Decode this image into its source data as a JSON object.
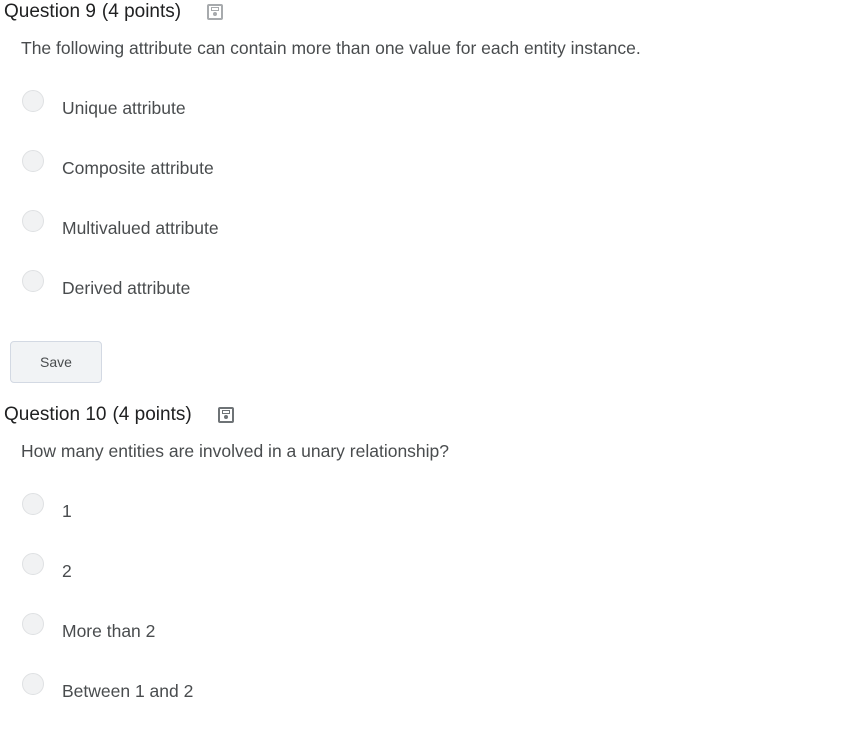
{
  "questions": [
    {
      "title": "Question 9",
      "points": "(4 points)",
      "prompt": "The following attribute can contain more than one value for each entity instance.",
      "options": [
        {
          "label": "Unique attribute"
        },
        {
          "label": "Composite attribute"
        },
        {
          "label": "Multivalued attribute"
        },
        {
          "label": "Derived attribute"
        }
      ]
    },
    {
      "title": "Question 10",
      "points": "(4 points)",
      "prompt": "How many entities are involved in a unary relationship?",
      "options": [
        {
          "label": "1"
        },
        {
          "label": "2"
        },
        {
          "label": "More than 2"
        },
        {
          "label": "Between 1 and 2"
        }
      ]
    }
  ],
  "save_button_label": "Save",
  "icons": {
    "question_status": "save-status-icon"
  }
}
